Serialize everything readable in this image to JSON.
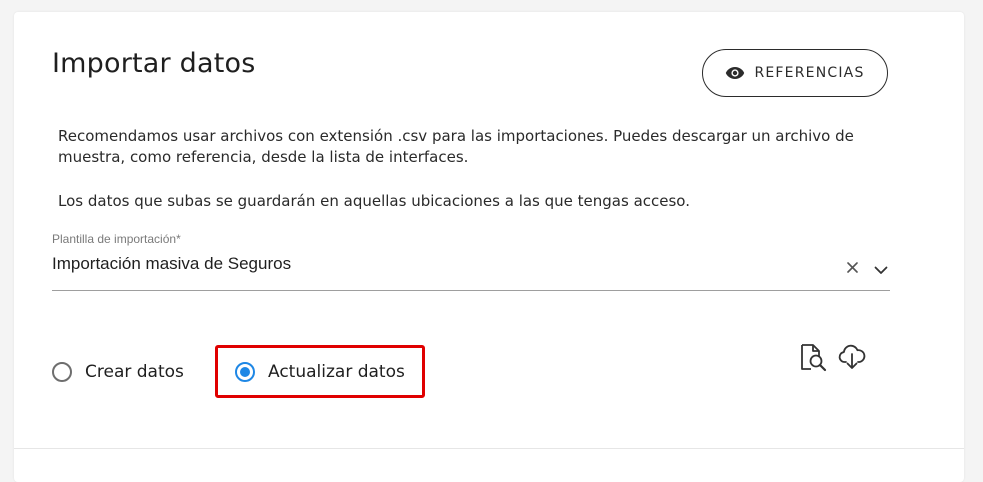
{
  "header": {
    "title": "Importar datos",
    "references_button": {
      "label": "REFERENCIAS",
      "icon": "eye-icon"
    }
  },
  "description": {
    "paragraph_1": "Recomendamos usar archivos con extensión .csv para las importaciones. Puedes descargar un archivo de muestra, como referencia, desde la lista de interfaces.",
    "paragraph_2": "Los datos que subas se guardarán en aquellas ubicaciones a las que tengas acceso."
  },
  "template_field": {
    "label": "Plantilla de importación*",
    "value": "Importación masiva de Seguros",
    "clear_icon": "close-icon",
    "dropdown_icon": "chevron-down-icon"
  },
  "mode_options": [
    {
      "label": "Crear datos",
      "selected": false
    },
    {
      "label": "Actualizar datos",
      "selected": true
    }
  ],
  "tools": {
    "preview_icon": "file-search-icon",
    "download_icon": "cloud-download-icon"
  },
  "colors": {
    "accent": "#1e87e5",
    "highlight": "#e00000"
  }
}
